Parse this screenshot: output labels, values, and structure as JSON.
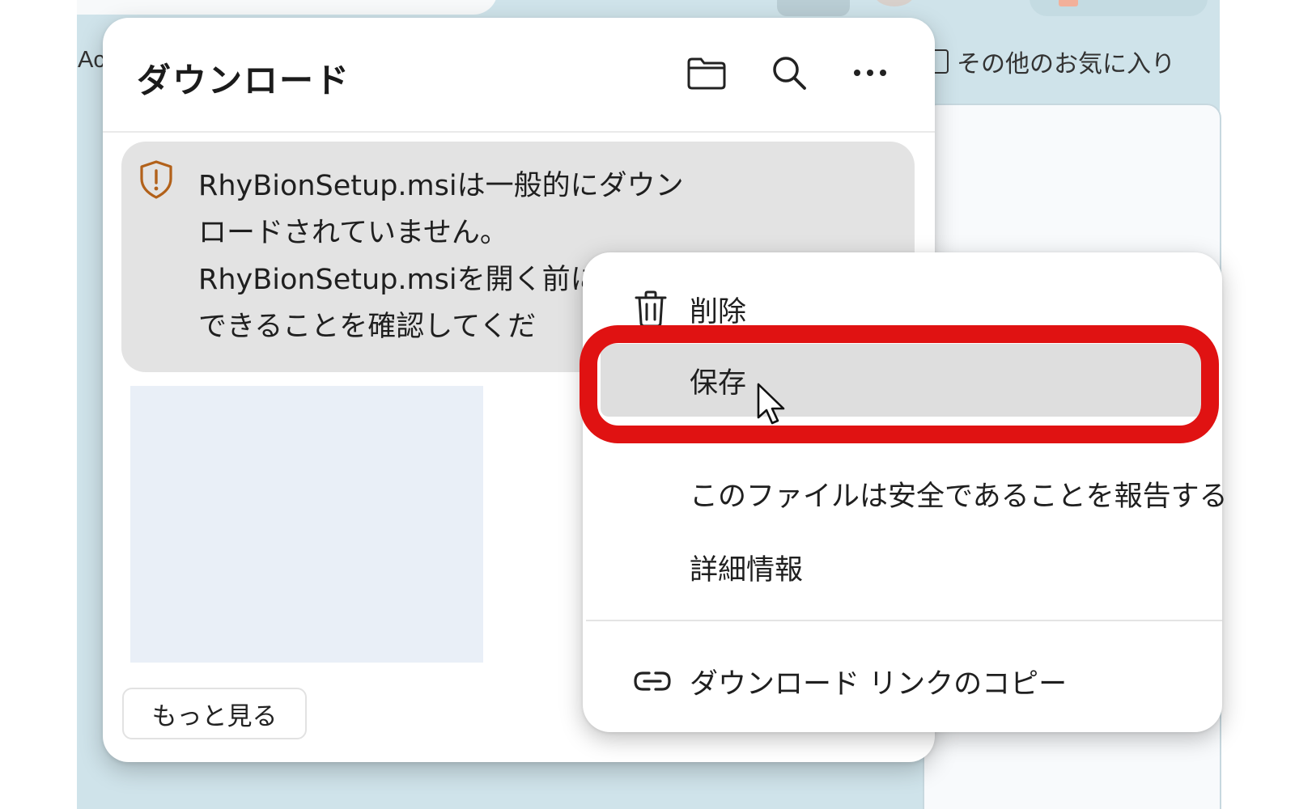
{
  "bookmarks_bar": {
    "left_partial": "Ac",
    "other_favorites": "その他のお気に入り"
  },
  "downloads_panel": {
    "title": "ダウンロード",
    "header_icons": [
      "folder-icon",
      "search-icon",
      "more-options-icon"
    ],
    "warning": {
      "line1": "RhyBionSetup.msiは一般的にダウン",
      "line2": "ロードされていません。",
      "line3": "RhyBionSetup.msiを開く前に",
      "line4": "できることを確認してくだ"
    },
    "more_button": "もっと見る"
  },
  "context_menu": {
    "items": [
      {
        "label": "削除",
        "icon": "trash-icon"
      },
      {
        "label": "保存"
      },
      {
        "label": "このファイルは安全であることを報告する"
      },
      {
        "label": "詳細情報"
      },
      {
        "label": "ダウンロード リンクのコピー",
        "icon": "link-icon"
      }
    ],
    "highlighted": "保存",
    "highlight_color": "#e01212"
  }
}
